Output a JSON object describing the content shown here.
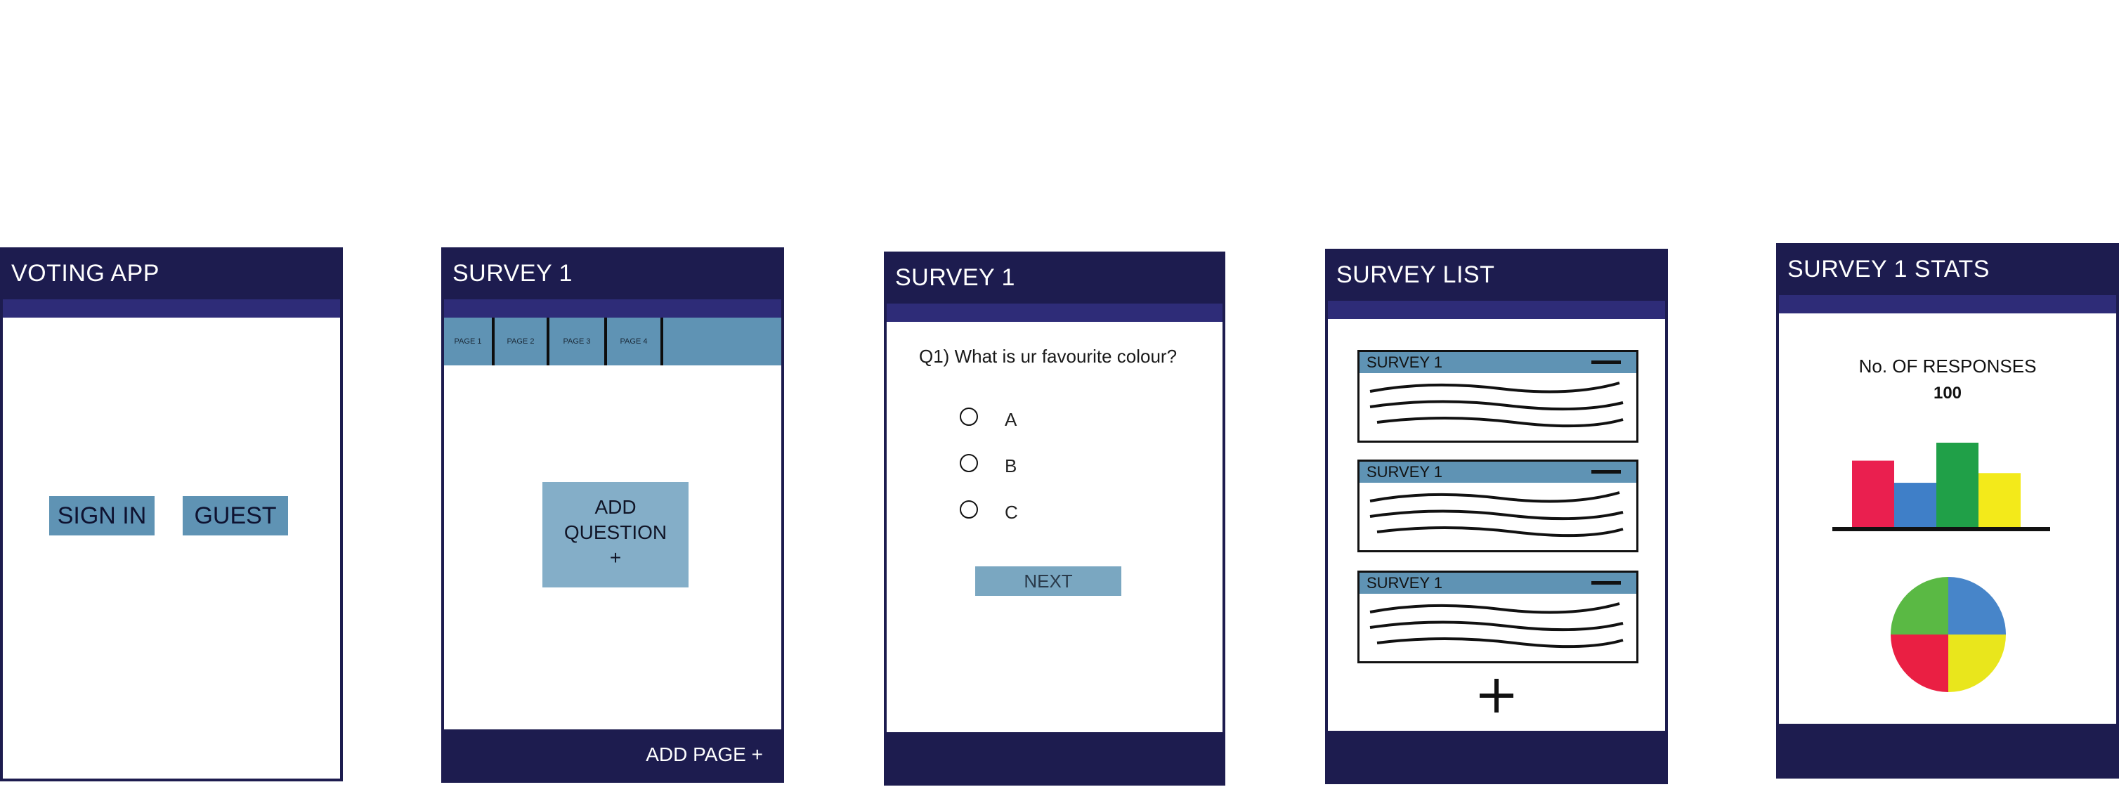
{
  "screens": {
    "login": {
      "title": "VOTING APP",
      "sign_in_label": "SIGN IN",
      "guest_label": "GUEST"
    },
    "editor": {
      "title": "SURVEY 1",
      "tabs": [
        "PAGE 1",
        "PAGE 2",
        "PAGE 3",
        "PAGE 4"
      ],
      "add_question_line1": "ADD",
      "add_question_line2": "QUESTION",
      "add_question_line3": "+",
      "add_page_label": "ADD PAGE +"
    },
    "question": {
      "title": "SURVEY 1",
      "question_text": "Q1) What is ur favourite colour?",
      "options": [
        "A",
        "B",
        "C"
      ],
      "next_label": "NEXT"
    },
    "list": {
      "title": "SURVEY LIST",
      "surveys": [
        "SURVEY 1",
        "SURVEY 1",
        "SURVEY 1"
      ],
      "add_icon": "plus-icon"
    },
    "stats": {
      "title": "SURVEY 1 STATS",
      "responses_label": "No. OF RESPONSES",
      "responses_value": "100"
    }
  },
  "colors": {
    "navy": "#1d1c4f",
    "subbar": "#2e2c78",
    "steel_blue": "#5f93b4",
    "light_blue": "#84aec8",
    "red": "#ea1f4f",
    "blue": "#3f7fc8",
    "green": "#20a048",
    "yellow": "#f3ea1a",
    "pie_green": "#5ab944",
    "pie_blue": "#4785c9",
    "pie_red": "#ea1f43",
    "pie_yellow": "#e9e61c"
  },
  "chart_data": [
    {
      "type": "bar",
      "categories": [
        "",
        "",
        "",
        ""
      ],
      "values": [
        48,
        32,
        61,
        39
      ],
      "colors": [
        "#ea1f4f",
        "#3f7fc8",
        "#20a048",
        "#f3ea1a"
      ]
    },
    {
      "type": "pie",
      "values": [
        25,
        25,
        25,
        25
      ],
      "colors": [
        "#4785c9",
        "#e9e61c",
        "#ea1f43",
        "#5ab944"
      ]
    }
  ]
}
